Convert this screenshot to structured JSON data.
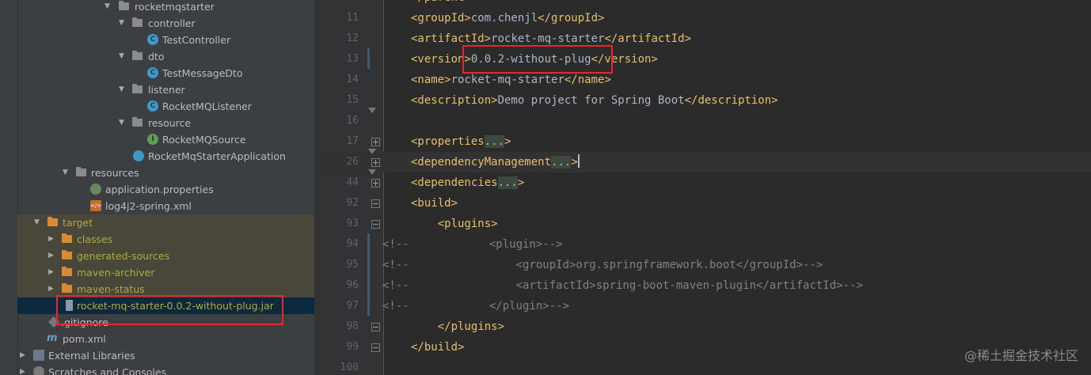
{
  "project_tree": {
    "items": [
      {
        "label": "rocketmqstarter",
        "kind": "folder"
      },
      {
        "label": "controller",
        "kind": "folder"
      },
      {
        "label": "TestController",
        "kind": "class",
        "icon_letter": "C"
      },
      {
        "label": "dto",
        "kind": "folder"
      },
      {
        "label": "TestMessageDto",
        "kind": "class",
        "icon_letter": "C"
      },
      {
        "label": "listener",
        "kind": "folder"
      },
      {
        "label": "RocketMQListener",
        "kind": "class",
        "icon_letter": "C"
      },
      {
        "label": "resource",
        "kind": "folder"
      },
      {
        "label": "RocketMQSource",
        "kind": "interface",
        "icon_letter": "I"
      },
      {
        "label": "RocketMqStarterApplication",
        "kind": "class"
      },
      {
        "label": "resources",
        "kind": "folder"
      },
      {
        "label": "application.properties",
        "kind": "properties"
      },
      {
        "label": "log4j2-spring.xml",
        "kind": "xml"
      },
      {
        "label": "target",
        "kind": "folder-excluded"
      },
      {
        "label": "classes",
        "kind": "folder-excluded"
      },
      {
        "label": "generated-sources",
        "kind": "folder-excluded"
      },
      {
        "label": "maven-archiver",
        "kind": "folder-excluded"
      },
      {
        "label": "maven-status",
        "kind": "folder-excluded"
      },
      {
        "label": "rocket-mq-starter-0.0.2-without-plug.jar",
        "kind": "jar",
        "selected": true
      },
      {
        "label": ".gitignore",
        "kind": "git"
      },
      {
        "label": "pom.xml",
        "kind": "pom"
      },
      {
        "label": "External Libraries",
        "kind": "libraries"
      },
      {
        "label": "Scratches and Consoles",
        "kind": "scratches"
      }
    ]
  },
  "editor": {
    "lines": [
      {
        "n": "",
        "parts": [
          [
            "t",
            "</parent>"
          ]
        ]
      },
      {
        "n": "11",
        "parts": [
          [
            "t",
            "<groupId>"
          ],
          [
            "txt",
            "com.chenjl"
          ],
          [
            "t",
            "</groupId>"
          ]
        ]
      },
      {
        "n": "12",
        "parts": [
          [
            "t",
            "<artifactId>"
          ],
          [
            "txt",
            "rocket-mq-starter"
          ],
          [
            "t",
            "</artifactId>"
          ]
        ]
      },
      {
        "n": "13",
        "parts": [
          [
            "t",
            "<version>"
          ],
          [
            "txt",
            "0.0.2-without-plug"
          ],
          [
            "t",
            "</version>"
          ]
        ]
      },
      {
        "n": "14",
        "parts": [
          [
            "t",
            "<name>"
          ],
          [
            "txt",
            "rocket-mq-starter"
          ],
          [
            "t",
            "</name>"
          ]
        ]
      },
      {
        "n": "15",
        "parts": [
          [
            "t",
            "<description>"
          ],
          [
            "txt",
            "Demo project for Spring Boot"
          ],
          [
            "t",
            "</description>"
          ]
        ]
      },
      {
        "n": "16",
        "parts": []
      },
      {
        "n": "17",
        "parts": [
          [
            "t",
            "<properties"
          ],
          [
            "fold",
            "..."
          ],
          [
            "t",
            ">"
          ]
        ]
      },
      {
        "n": "26",
        "parts": [
          [
            "t",
            "<dependencyManagement"
          ],
          [
            "fold",
            "..."
          ],
          [
            "t",
            ">"
          ]
        ]
      },
      {
        "n": "44",
        "parts": [
          [
            "t",
            "<dependencies"
          ],
          [
            "fold",
            "..."
          ],
          [
            "t",
            ">"
          ]
        ]
      },
      {
        "n": "92",
        "parts": [
          [
            "t",
            "<build>"
          ]
        ]
      },
      {
        "n": "93",
        "parts": [
          [
            "t",
            "    <plugins>"
          ]
        ]
      },
      {
        "n": "94",
        "parts": [
          [
            "cm",
            "<!--            <plugin>-->"
          ]
        ]
      },
      {
        "n": "95",
        "parts": [
          [
            "cm",
            "<!--                <groupId>org.springframework.boot</groupId>-->"
          ]
        ]
      },
      {
        "n": "96",
        "parts": [
          [
            "cm",
            "<!--                <artifactId>spring-boot-maven-plugin</artifactId>-->"
          ]
        ]
      },
      {
        "n": "97",
        "parts": [
          [
            "cm",
            "<!--            </plugin>-->"
          ]
        ]
      },
      {
        "n": "98",
        "parts": [
          [
            "t",
            "    </plugins>"
          ]
        ]
      },
      {
        "n": "99",
        "parts": [
          [
            "t",
            "</build>"
          ]
        ]
      },
      {
        "n": "100",
        "parts": []
      }
    ]
  },
  "watermark": "@稀土掘金技术社区",
  "colors": {
    "tag": "#e8bf6a",
    "text": "#a9b7c6",
    "comment": "#808080",
    "highlight_box": "#e8262b"
  }
}
